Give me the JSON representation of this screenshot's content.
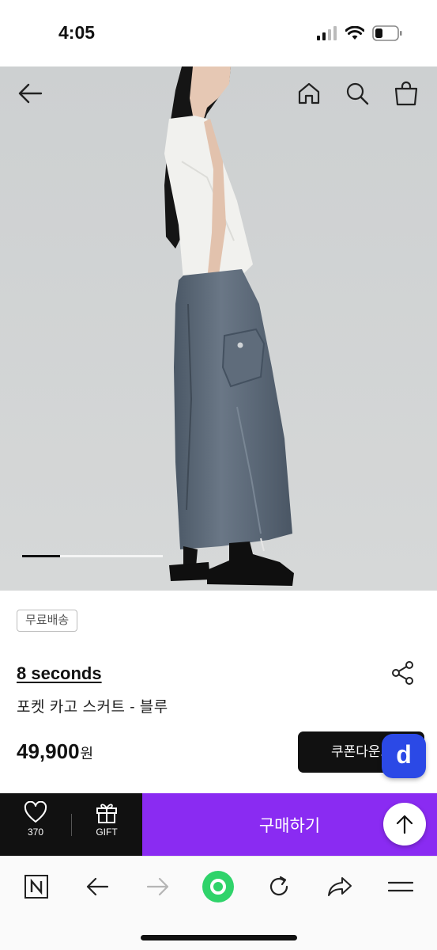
{
  "status_bar": {
    "time": "4:05"
  },
  "icons": {
    "back": "back-arrow-icon",
    "home": "home-icon",
    "search": "search-icon",
    "bag": "shopping-bag-icon",
    "share": "share-icon",
    "heart": "heart-icon",
    "gift": "gift-icon",
    "scroll_top": "arrow-up-icon",
    "naver": "naver-n-icon",
    "browser_back": "browser-back-icon",
    "browser_forward": "browser-forward-icon",
    "green_dot": "green-circle-icon",
    "reload": "reload-icon",
    "browser_share": "browser-share-icon",
    "menu": "menu-icon"
  },
  "gallery": {
    "progress": 0.27
  },
  "product": {
    "badge": "무료배송",
    "brand": "8 seconds",
    "name": "포켓 카고 스커트 - 블루",
    "price": "49,900",
    "currency": "원",
    "coupon_label": "쿠폰다운로드",
    "floating_badge": "d"
  },
  "buy_bar": {
    "like_count": "370",
    "gift_label": "GIFT",
    "buy_label": "구매하기"
  },
  "colors": {
    "buy_button": "#8a2bf2",
    "floating_badge": "#2b49e6",
    "hero_background": "#c9cccd"
  }
}
